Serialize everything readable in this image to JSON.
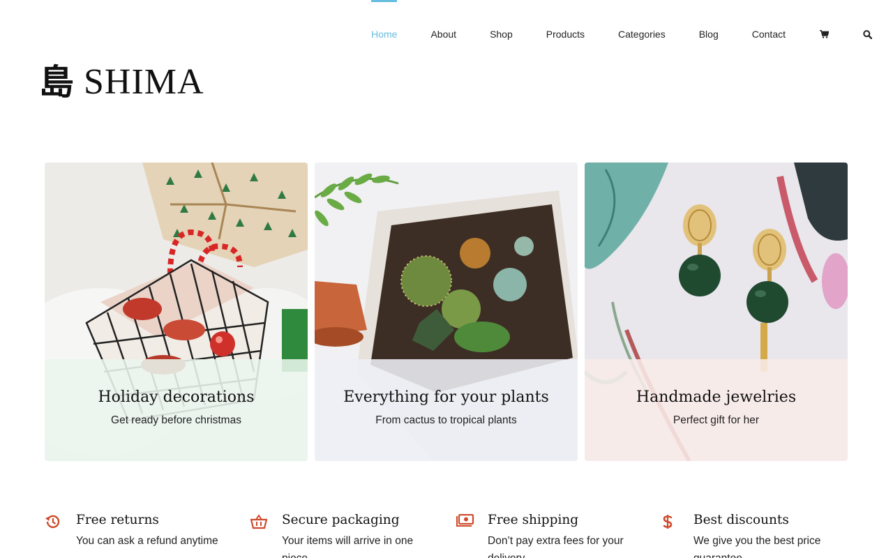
{
  "brand": {
    "glyph": "島",
    "name": "SHIMA"
  },
  "nav": {
    "items": [
      {
        "label": "Home",
        "active": true
      },
      {
        "label": "About"
      },
      {
        "label": "Shop"
      },
      {
        "label": "Products"
      },
      {
        "label": "Categories"
      },
      {
        "label": "Blog"
      },
      {
        "label": "Contact"
      }
    ],
    "icons": [
      "cart-icon",
      "search-icon"
    ]
  },
  "colors": {
    "accent": "#65bde0",
    "feature_icon": "#cf4a2b",
    "card1_overlay": "#eaf6ee",
    "card2_overlay": "#eeeff6",
    "card3_overlay": "#f8ece9"
  },
  "cards": [
    {
      "title": "Holiday decorations",
      "subtitle": "Get ready before christmas"
    },
    {
      "title": "Everything for your plants",
      "subtitle": "From cactus to tropical plants"
    },
    {
      "title": "Handmade jewelries",
      "subtitle": "Perfect gift for her"
    }
  ],
  "features": [
    {
      "icon": "history-icon",
      "title": "Free returns",
      "text": "You can ask a refund anytime"
    },
    {
      "icon": "basket-icon",
      "title": "Secure packaging",
      "text": "Your items will arrive in one piece"
    },
    {
      "icon": "money-icon",
      "title": "Free shipping",
      "text": "Don’t pay extra fees for your delivery"
    },
    {
      "icon": "dollar-icon",
      "title": "Best discounts",
      "text": "We give you the best price guarantee"
    }
  ]
}
